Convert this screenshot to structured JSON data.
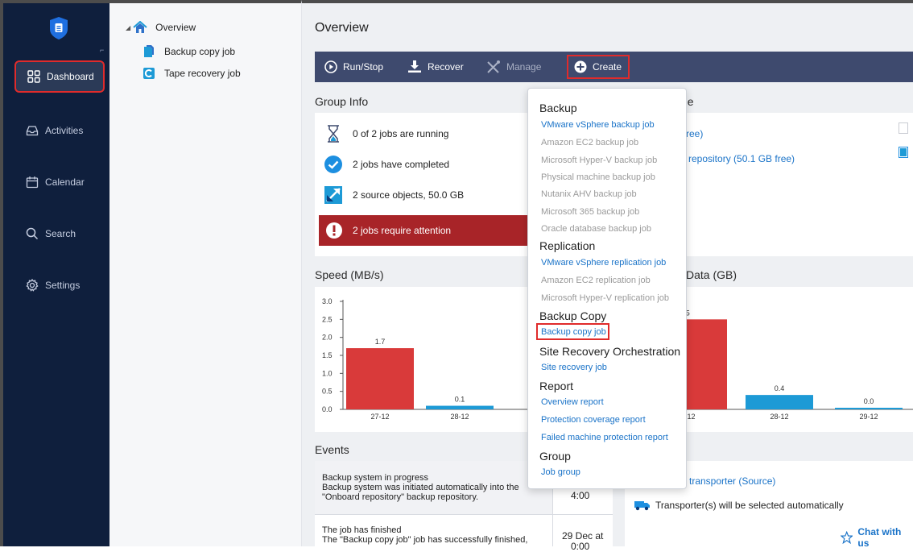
{
  "nav": {
    "items": [
      {
        "label": "Dashboard",
        "icon": "dashboard-icon"
      },
      {
        "label": "Activities",
        "icon": "activities-icon"
      },
      {
        "label": "Calendar",
        "icon": "calendar-icon"
      },
      {
        "label": "Search",
        "icon": "search-icon"
      },
      {
        "label": "Settings",
        "icon": "settings-icon"
      }
    ],
    "corner_mark": "⌐"
  },
  "tree": {
    "root": "Overview",
    "children": [
      "Backup copy job",
      "Tape recovery job"
    ]
  },
  "page_title": "Overview",
  "toolbar": {
    "run_stop": "Run/Stop",
    "recover": "Recover",
    "manage": "Manage",
    "create": "Create"
  },
  "group_info": {
    "title": "Group Info",
    "running": "0 of 2 jobs are running",
    "completed": "2 jobs have completed",
    "objects": "2 source objects, 50.0 GB",
    "attention": "2 jobs require attention"
  },
  "storage": {
    "title_fragment": "ge",
    "item1": "ree)",
    "item2": "repository (50.1 GB free)"
  },
  "speed_chart": {
    "title": "Speed (MB/s)",
    "yticks": [
      "3.0",
      "2.5",
      "2.0",
      "1.5",
      "1.0",
      "0.5",
      "0.0"
    ]
  },
  "data_chart": {
    "title": "Data (GB)"
  },
  "chart_data": [
    {
      "type": "bar",
      "title": "Speed (MB/s)",
      "categories": [
        "27-12",
        "28-12"
      ],
      "values": [
        1.7,
        0.1
      ],
      "data_labels": [
        "1.7",
        "0.1"
      ],
      "ylim": [
        0,
        3.0
      ],
      "colors": [
        "#d93a3a",
        "#1d9ad6"
      ]
    },
    {
      "type": "bar",
      "title": "Data (GB)",
      "categories": [
        "-12",
        "28-12",
        "29-12"
      ],
      "values": [
        2.5,
        0.4,
        0.0
      ],
      "data_labels": [
        ".5",
        "0.4",
        "0.0"
      ],
      "colors": [
        "#d93a3a",
        "#1d9ad6",
        "#1d9ad6"
      ]
    }
  ],
  "events": {
    "title": "Events",
    "rows": [
      {
        "line1": "Backup system in progress",
        "line2": "Backup system was initiated automatically into the",
        "line3": "\"Onboard repository\" backup repository.",
        "time": "4:00"
      },
      {
        "line1": "The job has finished",
        "line2": "The \"Backup copy job\" job has successfully finished,",
        "time1": "29 Dec at",
        "time2": "0:00"
      }
    ]
  },
  "transporter": {
    "source": "transporter (Source)",
    "auto": "Transporter(s) will be selected automatically"
  },
  "chat": "Chat with us",
  "dropdown": {
    "backup_header": "Backup",
    "backup_items": [
      {
        "label": "VMware vSphere backup job",
        "enabled": true
      },
      {
        "label": "Amazon EC2 backup job",
        "enabled": false
      },
      {
        "label": "Microsoft Hyper-V backup job",
        "enabled": false
      },
      {
        "label": "Physical machine backup job",
        "enabled": false
      },
      {
        "label": "Nutanix AHV backup job",
        "enabled": false
      },
      {
        "label": "Microsoft 365 backup job",
        "enabled": false
      },
      {
        "label": "Oracle database backup job",
        "enabled": false
      }
    ],
    "replication_header": "Replication",
    "replication_items": [
      {
        "label": "VMware vSphere replication job",
        "enabled": true
      },
      {
        "label": "Amazon EC2 replication job",
        "enabled": false
      },
      {
        "label": "Microsoft Hyper-V replication job",
        "enabled": false
      }
    ],
    "backup_copy_header": "Backup Copy",
    "backup_copy_item": "Backup copy job",
    "site_recovery_header": "Site Recovery Orchestration",
    "site_recovery_item": "Site recovery job",
    "report_header": "Report",
    "report_items": [
      "Overview report",
      "Protection coverage report",
      "Failed machine protection report"
    ],
    "group_header": "Group",
    "group_item": "Job group"
  }
}
